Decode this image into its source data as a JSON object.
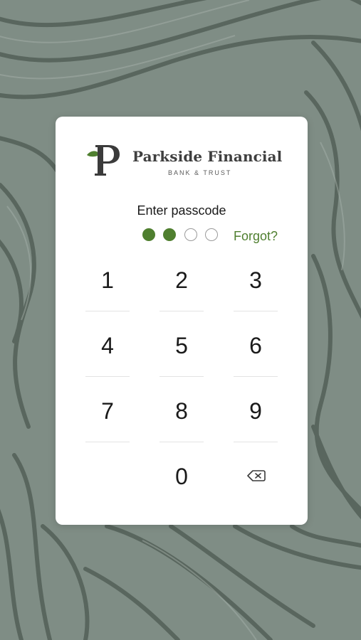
{
  "brand": {
    "name": "Parkside Financial",
    "subtitle": "BANK & TRUST",
    "accent_color": "#4f7f2f"
  },
  "passcode": {
    "title": "Enter passcode",
    "length": 4,
    "entered": 2,
    "forgot_label": "Forgot?"
  },
  "keypad": {
    "keys": [
      "1",
      "2",
      "3",
      "4",
      "5",
      "6",
      "7",
      "8",
      "9",
      "0"
    ],
    "backspace_icon": "backspace-icon"
  }
}
